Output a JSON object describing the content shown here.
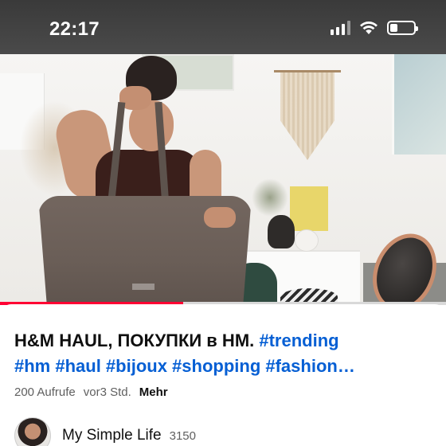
{
  "status_bar": {
    "time": "22:17"
  },
  "video": {
    "progress_fraction": 0.41,
    "progress_color": "#ff0033"
  },
  "info": {
    "title_plain": "H&M HAUL, ПОКУПКИ в НМ. ",
    "title_tag_1": "#trending",
    "title_tags_line2": "#hm #haul #bijoux #shopping #fashion…",
    "views": "200 Aufrufe",
    "age": "vor3 Std.",
    "more": "Mehr",
    "hashtag_color": "#065fd4"
  },
  "channel": {
    "name": "My Simple Life",
    "subscribers": "3150"
  },
  "icons": [
    "signal-icon",
    "wifi-icon",
    "battery-icon"
  ]
}
